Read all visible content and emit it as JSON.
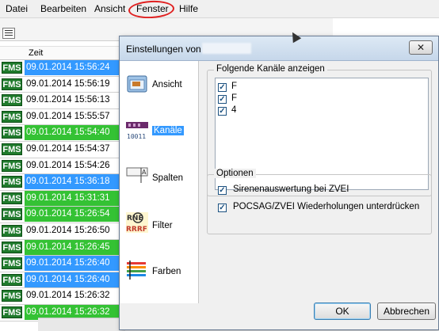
{
  "menubar": {
    "items": [
      "Datei",
      "Bearbeiten",
      "Ansicht",
      "Fenster",
      "Hilfe"
    ],
    "highlight_color": "#e02020"
  },
  "list": {
    "column_header": "Zeit",
    "badge": "FMS",
    "rows": [
      {
        "time": "09.01.2014 15:56:24",
        "color": "blue"
      },
      {
        "time": "09.01.2014 15:56:19",
        "color": "white"
      },
      {
        "time": "09.01.2014 15:56:13",
        "color": "white"
      },
      {
        "time": "09.01.2014 15:55:57",
        "color": "white"
      },
      {
        "time": "09.01.2014 15:54:40",
        "color": "green"
      },
      {
        "time": "09.01.2014 15:54:37",
        "color": "white"
      },
      {
        "time": "09.01.2014 15:54:26",
        "color": "white"
      },
      {
        "time": "09.01.2014 15:36:18",
        "color": "blue"
      },
      {
        "time": "09.01.2014 15:31:31",
        "color": "green"
      },
      {
        "time": "09.01.2014 15:26:54",
        "color": "green"
      },
      {
        "time": "09.01.2014 15:26:50",
        "color": "white"
      },
      {
        "time": "09.01.2014 15:26:45",
        "color": "green"
      },
      {
        "time": "09.01.2014 15:26:40",
        "color": "blue"
      },
      {
        "time": "09.01.2014 15:26:40",
        "color": "blue"
      },
      {
        "time": "09.01.2014 15:26:32",
        "color": "white"
      },
      {
        "time": "09.01.2014 15:26:32",
        "color": "green"
      }
    ],
    "colors": {
      "blue": "#3399ff",
      "green": "#34c234",
      "white": "#ffffff"
    }
  },
  "dialog": {
    "title": "Einstellungen von",
    "close_label": "✕",
    "nav": [
      {
        "label": "Ansicht",
        "icon": "window-icon",
        "selected": false
      },
      {
        "label": "Kanäle",
        "icon": "channels-icon",
        "selected": true
      },
      {
        "label": "Spalten",
        "icon": "columns-icon",
        "selected": false
      },
      {
        "label": "Filter",
        "icon": "filter-icon",
        "selected": false
      },
      {
        "label": "Farben",
        "icon": "colors-icon",
        "selected": false
      }
    ],
    "channels_group": {
      "title": "Folgende Kanäle anzeigen",
      "items": [
        {
          "label": "F",
          "checked": true
        },
        {
          "label": "F",
          "checked": true
        },
        {
          "label": "4",
          "checked": true
        }
      ]
    },
    "options_group": {
      "title": "Optionen",
      "items": [
        {
          "label": "Sirenenauswertung bei ZVEI",
          "checked": true
        },
        {
          "label": "POCSAG/ZVEI Wiederholungen unterdrücken",
          "checked": true
        }
      ]
    },
    "ok_label": "OK",
    "cancel_label": "Abbrechen"
  }
}
